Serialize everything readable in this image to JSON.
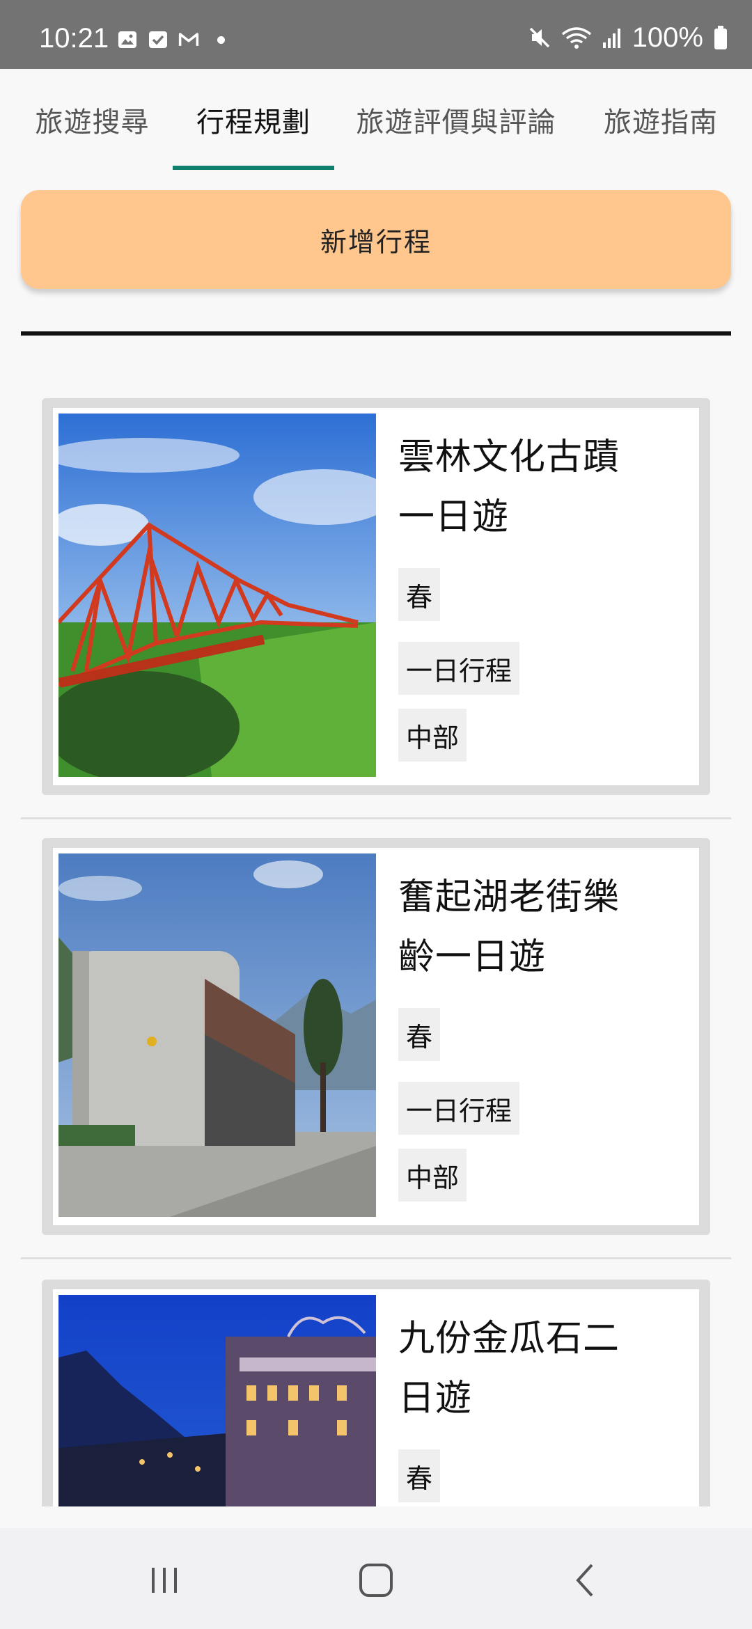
{
  "status_bar": {
    "time": "10:21",
    "battery": "100%",
    "icons": [
      "image-icon",
      "check-icon",
      "gmail-icon",
      "dot-icon",
      "mute-icon",
      "wifi-icon",
      "signal-icon",
      "battery-icon"
    ]
  },
  "tabs": [
    {
      "label": "旅遊搜尋",
      "active": false
    },
    {
      "label": "行程規劃",
      "active": true
    },
    {
      "label": "旅遊評價與評論",
      "active": false
    },
    {
      "label": "旅遊指南",
      "active": false
    }
  ],
  "add_button": {
    "label": "新增行程"
  },
  "trips": [
    {
      "title_line1": "雲林文化古蹟",
      "title_line2": "一日遊",
      "tags": [
        "春",
        "一日行程",
        "中部"
      ],
      "image": "red-bridge-photo"
    },
    {
      "title_line1": "奮起湖老街樂",
      "title_line2": "齡一日遊",
      "tags": [
        "春",
        "一日行程",
        "中部"
      ],
      "image": "concrete-building-photo"
    },
    {
      "title_line1": "九份金瓜石二",
      "title_line2": "日遊",
      "tags": [
        "春"
      ],
      "image": "jiufen-night-photo"
    }
  ],
  "colors": {
    "status_bar": "#737373",
    "tab_indicator": "#0f7f6e",
    "add_button": "#ffc68e",
    "card_border": "#dcdcdc",
    "tag_bg": "#efefef"
  }
}
